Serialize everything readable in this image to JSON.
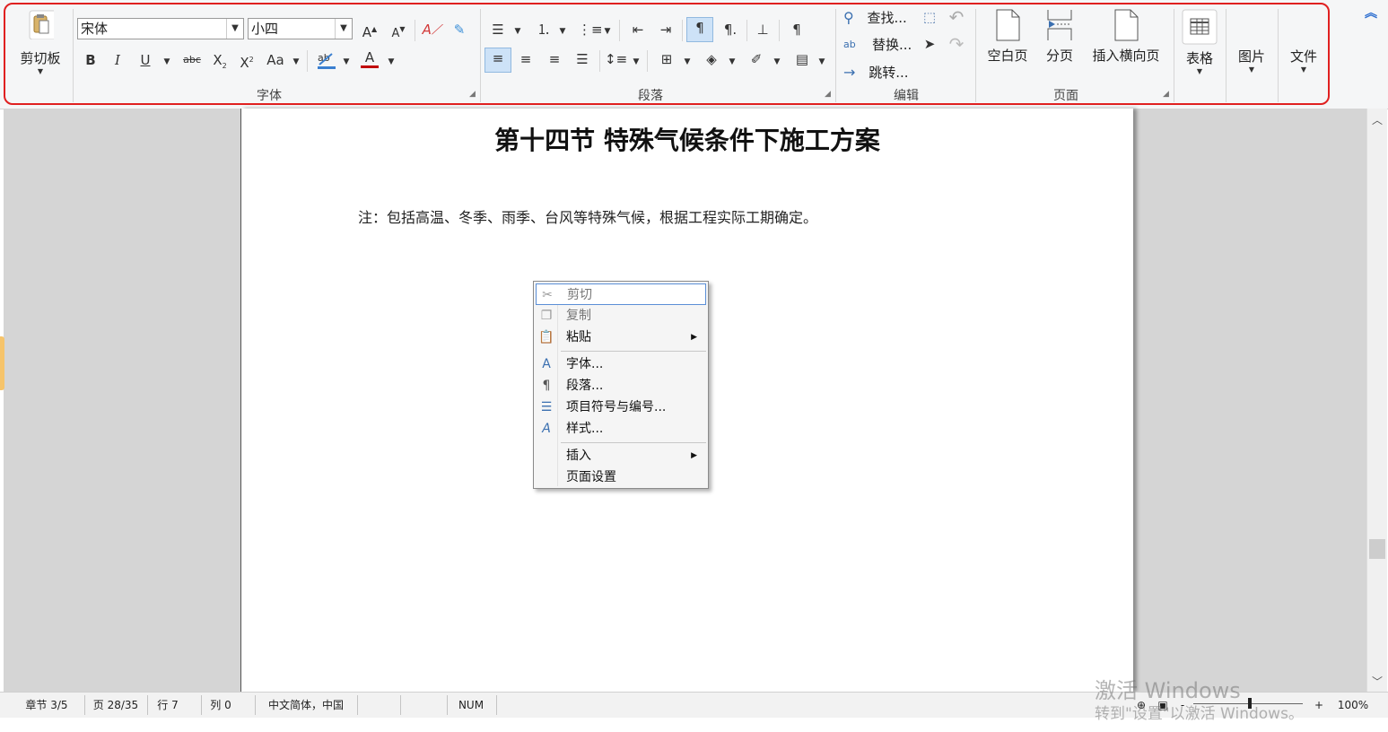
{
  "ribbon": {
    "clipboard": {
      "label": "剪切板",
      "icon": "clipboard-paste-icon"
    },
    "font": {
      "group_label": "字体",
      "font_name": "宋体",
      "font_size": "小四",
      "grow_label": "A",
      "shrink_label": "A",
      "bold": "B",
      "italic": "I",
      "underline": "U",
      "strikethrough": "abc",
      "subscript": "X",
      "superscript": "X",
      "change_case": "Aa",
      "font_color": "A"
    },
    "paragraph": {
      "group_label": "段落"
    },
    "editing": {
      "group_label": "编辑",
      "find": "查找...",
      "replace": "替换...",
      "goto": "跳转..."
    },
    "pages": {
      "group_label": "页面",
      "blank_page": "空白页",
      "page_break": "分页",
      "landscape_page": "插入横向页"
    },
    "table": "表格",
    "picture": "图片",
    "file": "文件",
    "highlight_color": "#e02020"
  },
  "document": {
    "title": "第十四节  特殊气候条件下施工方案",
    "note": "注：包括高温、冬季、雨季、台风等特殊气候，根据工程实际工期确定。"
  },
  "context_menu": {
    "cut": "剪切",
    "copy": "复制",
    "paste": "粘贴",
    "font": "字体...",
    "paragraph": "段落...",
    "bullets": "项目符号与编号...",
    "style": "样式...",
    "insert": "插入",
    "page_setup": "页面设置"
  },
  "status": {
    "section": "章节 3/5",
    "page": "页 28/35",
    "row": "行 7",
    "col": "列 0",
    "language": "中文简体，中国",
    "num": "NUM",
    "zoom": "100%",
    "zoom_minus": "-",
    "zoom_plus": "+"
  },
  "watermark": {
    "line1": "激活 Windows",
    "line2": "转到\"设置\"以激活 Windows。"
  }
}
